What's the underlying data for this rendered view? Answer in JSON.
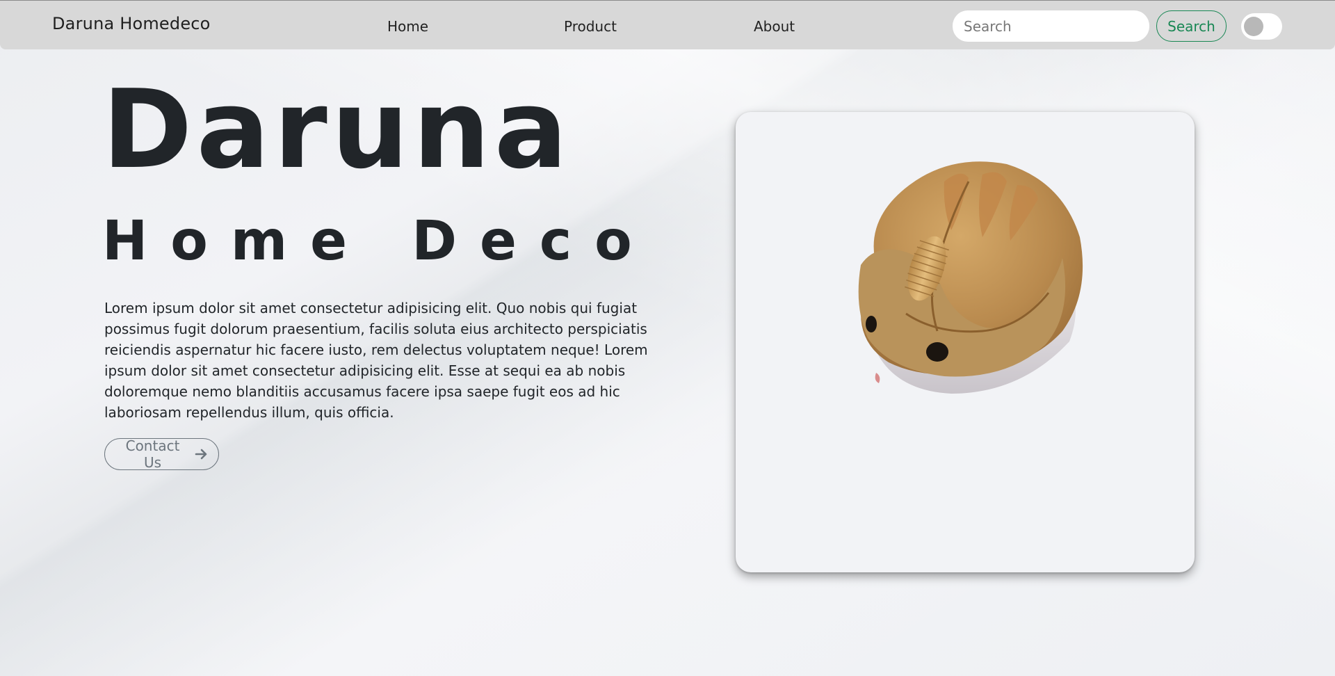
{
  "navbar": {
    "brand": "Daruna Homedeco",
    "links": [
      {
        "label": "Home"
      },
      {
        "label": "Product"
      },
      {
        "label": "About"
      }
    ],
    "search": {
      "placeholder": "Search",
      "value": "",
      "button_label": "Search"
    },
    "theme_toggle": {
      "state": "off"
    }
  },
  "hero": {
    "title": "Daruna",
    "subtitle": "Home Deco",
    "description": "Lorem ipsum dolor sit amet consectetur adipisicing elit. Quo nobis qui fugiat possimus fugit dolorum praesentium, facilis soluta eius architecto perspiciatis reiciendis aspernatur hic facere iusto, rem delectus voluptatem neque! Lorem ipsum dolor sit amet consectetur adipisicing elit. Esse at sequi ea ab nobis doloremque nemo blanditiis accusamus facere ipsa saepe fugit eos ad hic laboriosam repellendus illum, quis officia.",
    "cta_label": "Contact Us",
    "cta_icon": "arrow-right-icon"
  },
  "product_card": {
    "image": "hamster-mouse"
  },
  "colors": {
    "accent_green": "#198754",
    "navbar_bg": "#d8d8d8",
    "text_dark": "#212529",
    "muted": "#6c757d"
  }
}
